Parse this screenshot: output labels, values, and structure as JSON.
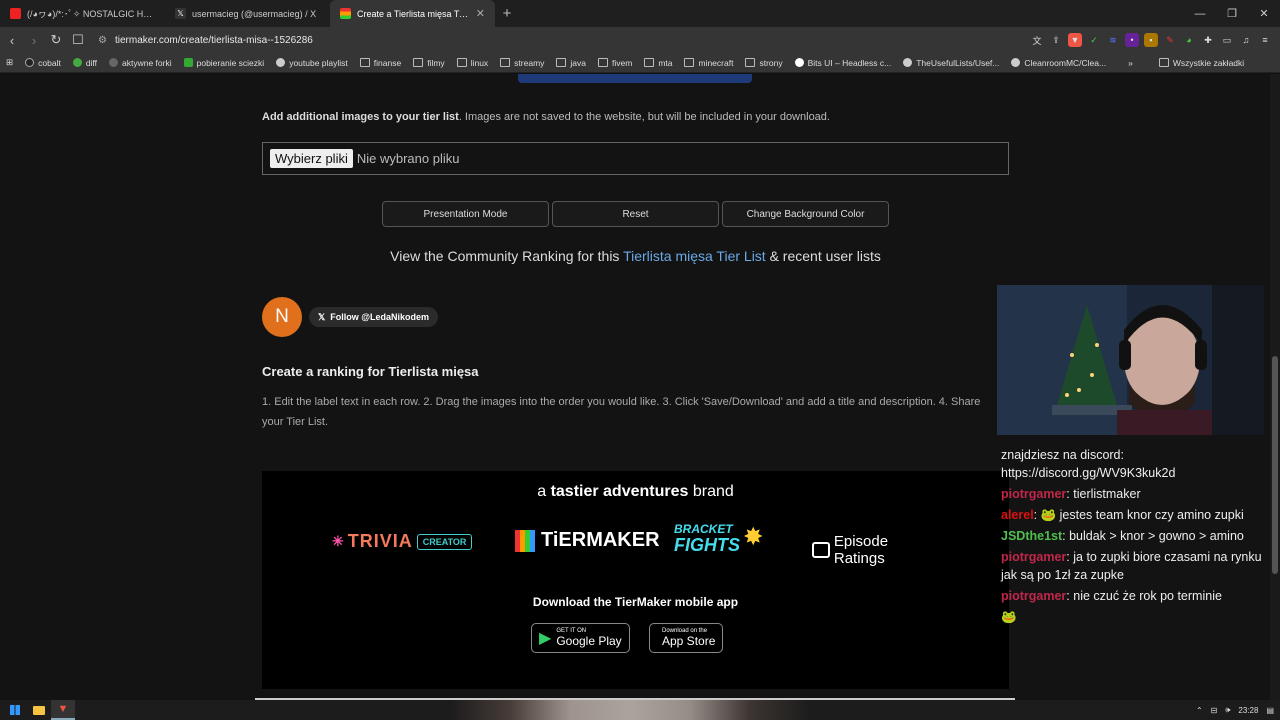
{
  "browser": {
    "tabs": [
      {
        "label": "(/◕ヮ◕)/*:･ﾟ✧ NOSTALGIC HEXD",
        "fav_color": "#e22",
        "active": false
      },
      {
        "label": "usermacieg (@usermacieg) / X",
        "fav_color": "#333",
        "active": false
      },
      {
        "label": "Create a Tierlista mięsa Tier List",
        "fav_color": "#222",
        "active": true
      }
    ],
    "new_tab": "+",
    "url": "tiermaker.com/create/tierlista-misa--1526286"
  },
  "bookmarks": [
    "cobalt",
    "diff",
    "aktywne forki",
    "pobieranie sciezki",
    "youtube playlist",
    "finanse",
    "filmy",
    "linux",
    "streamy",
    "java",
    "fivem",
    "mta",
    "minecraft",
    "strony",
    "Bits UI – Headless c...",
    "TheUsefulLists/Usef...",
    "CleanroomMC/Clea..."
  ],
  "bookmarks_other": "Wszystkie zakładki",
  "page": {
    "add_images_bold": "Add additional images to your tier list",
    "add_images_rest": ". Images are not saved to the website, but will be included in your download.",
    "file_button": "Wybierz pliki",
    "file_status": "Nie wybrano pliku",
    "buttons": [
      "Presentation Mode",
      "Reset",
      "Change Background Color"
    ],
    "community_pre": "View the Community Ranking for this ",
    "community_link": "Tierlista mięsa Tier List",
    "community_post": " & recent user lists",
    "avatar_letter": "N",
    "follow_label": "Follow @LedaNikodem",
    "create_title": "Create a ranking for Tierlista mięsa",
    "instructions": "1. Edit the label text in each row. 2. Drag the images into the order you would like. 3. Click 'Save/Download' and add a title and description. 4. Share your Tier List.",
    "brand_pre": "a ",
    "brand_bold": "tastier adventures",
    "brand_post": " brand",
    "logos": {
      "trivia": "TRIVIA",
      "creator": "CREATOR",
      "tiermaker": "TiERMAKER",
      "bracket": "BRACKET",
      "fights": "FIGHTS",
      "episode": "Episode Ratings"
    },
    "download_title": "Download the TierMaker mobile app",
    "google_small": "GET IT ON",
    "google_big": "Google Play",
    "apple_small": "Download on the",
    "apple_big": "App Store"
  },
  "chat": [
    {
      "user": "",
      "color": "#eee",
      "text": "znajdziesz na discord: https://discord.gg/WV9K3kuk2d"
    },
    {
      "user": "piotrgamer",
      "color": "#c0274a",
      "text": ": tierlistmaker"
    },
    {
      "user": "alerel",
      "color": "#d11",
      "text": ": 🐸 jestes team knor czy amino zupki"
    },
    {
      "user": "JSDthe1st",
      "color": "#4fbe4f",
      "text": ": buldak > knor > gowno > amino"
    },
    {
      "user": "piotrgamer",
      "color": "#c0274a",
      "text": ": ja to zupki biore czasami na rynku jak są po 1zł za zupke"
    },
    {
      "user": "piotrgamer",
      "color": "#c0274a",
      "text": ": nie czuć że rok po terminie"
    },
    {
      "user": "",
      "color": "#eee",
      "text": "🐸"
    }
  ],
  "taskbar": {
    "time": "23:28"
  }
}
